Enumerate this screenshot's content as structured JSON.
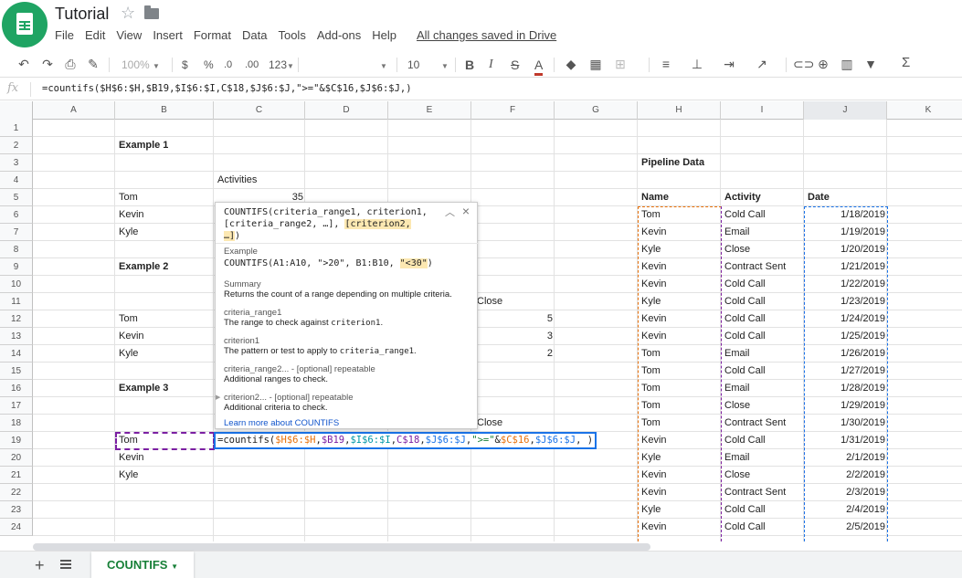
{
  "app": {
    "title": "Tutorial",
    "saved_status": "All changes saved in Drive",
    "menu": [
      "File",
      "Edit",
      "View",
      "Insert",
      "Format",
      "Data",
      "Tools",
      "Add-ons",
      "Help"
    ]
  },
  "toolbar": {
    "zoom": "100%",
    "currency": "$",
    "percent": "%",
    "dec_decrease": ".0",
    "dec_increase": ".00",
    "number_format": "123",
    "font_size": "10",
    "bold": "B",
    "italic": "I",
    "strike": "S",
    "text_color": "A",
    "functions": "Σ"
  },
  "formula_bar": {
    "fx": "fx",
    "formula": "=countifs($H$6:$H,$B19,$I$6:$I,C$18,$J$6:$J,\">=\"&$C$16,$J$6:$J,)"
  },
  "columns": [
    "A",
    "B",
    "C",
    "D",
    "E",
    "F",
    "G",
    "H",
    "I",
    "J",
    "K"
  ],
  "rows": [
    "1",
    "2",
    "3",
    "4",
    "5",
    "6",
    "7",
    "8",
    "9",
    "10",
    "11",
    "12",
    "13",
    "14",
    "15",
    "16",
    "17",
    "18",
    "19",
    "20",
    "21",
    "22",
    "23",
    "24"
  ],
  "cells": {
    "b2": "Example 1",
    "c4": "Activities",
    "b5": "Tom",
    "c5": "35",
    "b6": "Kevin",
    "b7": "Kyle",
    "b9": "Example 2",
    "e11": "Close",
    "b12": "Tom",
    "f12": "5",
    "b13": "Kevin",
    "f13": "3",
    "b14": "Kyle",
    "f14": "2",
    "b16": "Example 3",
    "e18": "Close",
    "b19": "Tom",
    "b20": "Kevin",
    "b21": "Kyle",
    "h3": "Pipeline Data"
  },
  "pipeline": {
    "headers": [
      "Name",
      "Activity",
      "Date"
    ],
    "rows": [
      [
        "Tom",
        "Cold Call",
        "1/18/2019"
      ],
      [
        "Kevin",
        "Email",
        "1/19/2019"
      ],
      [
        "Kyle",
        "Close",
        "1/20/2019"
      ],
      [
        "Kevin",
        "Contract Sent",
        "1/21/2019"
      ],
      [
        "Kevin",
        "Cold Call",
        "1/22/2019"
      ],
      [
        "Kyle",
        "Cold Call",
        "1/23/2019"
      ],
      [
        "Kevin",
        "Cold Call",
        "1/24/2019"
      ],
      [
        "Kevin",
        "Cold Call",
        "1/25/2019"
      ],
      [
        "Tom",
        "Email",
        "1/26/2019"
      ],
      [
        "Tom",
        "Cold Call",
        "1/27/2019"
      ],
      [
        "Tom",
        "Email",
        "1/28/2019"
      ],
      [
        "Tom",
        "Close",
        "1/29/2019"
      ],
      [
        "Tom",
        "Contract Sent",
        "1/30/2019"
      ],
      [
        "Kevin",
        "Cold Call",
        "1/31/2019"
      ],
      [
        "Kyle",
        "Email",
        "2/1/2019"
      ],
      [
        "Kevin",
        "Close",
        "2/2/2019"
      ],
      [
        "Kevin",
        "Contract Sent",
        "2/3/2019"
      ],
      [
        "Kyle",
        "Cold Call",
        "2/4/2019"
      ],
      [
        "Kevin",
        "Cold Call",
        "2/5/2019"
      ]
    ]
  },
  "help": {
    "signature_start": "COUNTIFS(criteria_range1, criterion1,",
    "signature_mid": "[criteria_range2, …], ",
    "signature_hl": "[criterion2,",
    "signature_end": "…]",
    "signature_close": ")",
    "example_label": "Example",
    "example_code": "COUNTIFS(A1:A10, \">20\", B1:B10, ",
    "example_hl": "\"<30\"",
    "example_close": ")",
    "summary_label": "Summary",
    "summary_text": "Returns the count of a range depending on multiple criteria.",
    "arg1_label": "criteria_range1",
    "arg1_text": "The range to check against ",
    "arg1_code": "criterion1",
    "arg1_end": ".",
    "arg2_label": "criterion1",
    "arg2_text": "The pattern or test to apply to ",
    "arg2_code": "criteria_range1",
    "arg2_end": ".",
    "arg3_label": "criteria_range2... - [optional] repeatable",
    "arg3_text": "Additional ranges to check.",
    "arg4_label": "criterion2... - [optional] repeatable",
    "arg4_text": "Additional criteria to check.",
    "learn_more": "Learn more about COUNTIFS"
  },
  "edit_cell": {
    "p1": "=countifs(",
    "p2": "$H$6:$H",
    "p3": ",",
    "p4": "$B19",
    "p5": ",",
    "p6": "$I$6:$I",
    "p7": ",",
    "p8": "C$18",
    "p9": ",",
    "p10": "$J$6:$J",
    "p11": ",",
    "p12": "\">=\"",
    "p13": "&",
    "p14": "$C$16",
    "p15": ",",
    "p16": "$J$6:$J",
    "p17": ", )"
  },
  "sheet": {
    "add": "+",
    "tab_label": "COUNTIFS"
  },
  "colors": {
    "orange_ref": "#e8710a",
    "purple_ref": "#7b1fa2",
    "teal_ref": "#0097a7",
    "blue_ref": "#1a73e8",
    "green_ref": "#188038",
    "brand_green": "#1fa463"
  }
}
